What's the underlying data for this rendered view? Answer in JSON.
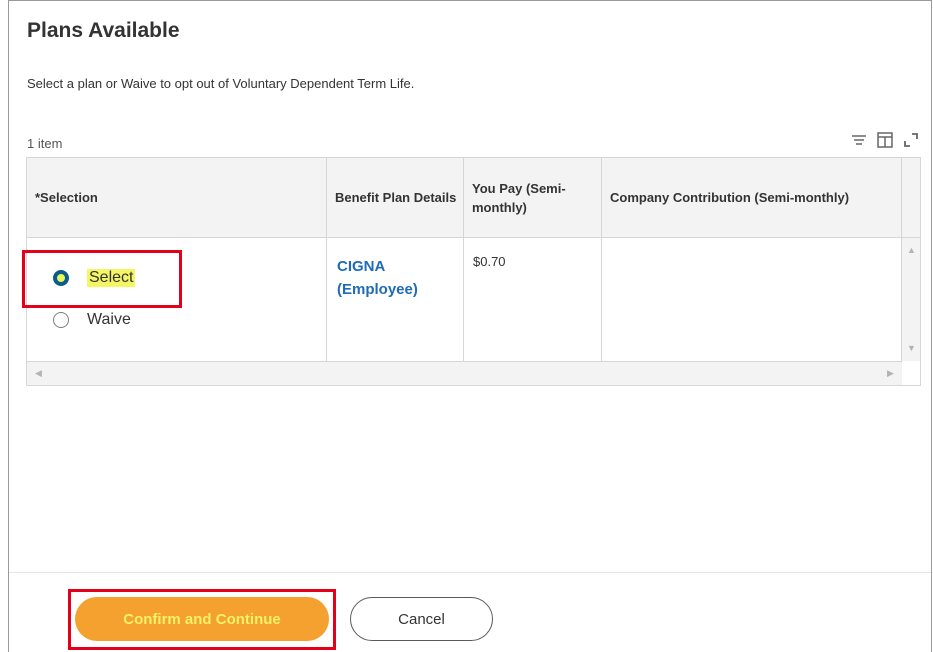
{
  "page": {
    "title": "Plans Available",
    "instruction": "Select a plan or Waive to opt out of Voluntary Dependent Term Life.",
    "item_count": "1 item"
  },
  "table": {
    "columns": [
      "*Selection",
      "Benefit Plan Details",
      "You Pay (Semi-monthly)",
      "Company Contribution (Semi-monthly)"
    ],
    "row": {
      "options": [
        {
          "label": "Select",
          "checked": true
        },
        {
          "label": "Waive",
          "checked": false
        }
      ],
      "plan": "CIGNA (Employee)",
      "you_pay": "$0.70",
      "company_contribution": ""
    }
  },
  "toolbar": {
    "icons": [
      "filter-icon",
      "columns-icon",
      "expand-icon"
    ]
  },
  "buttons": {
    "confirm": "Confirm and Continue",
    "cancel": "Cancel"
  },
  "colors": {
    "primary_button": "#f5a130",
    "highlight": "#f4f763",
    "annotation_box": "#e2001a",
    "link": "#1f6bb6",
    "radio_checked": "#0b5b8f"
  }
}
